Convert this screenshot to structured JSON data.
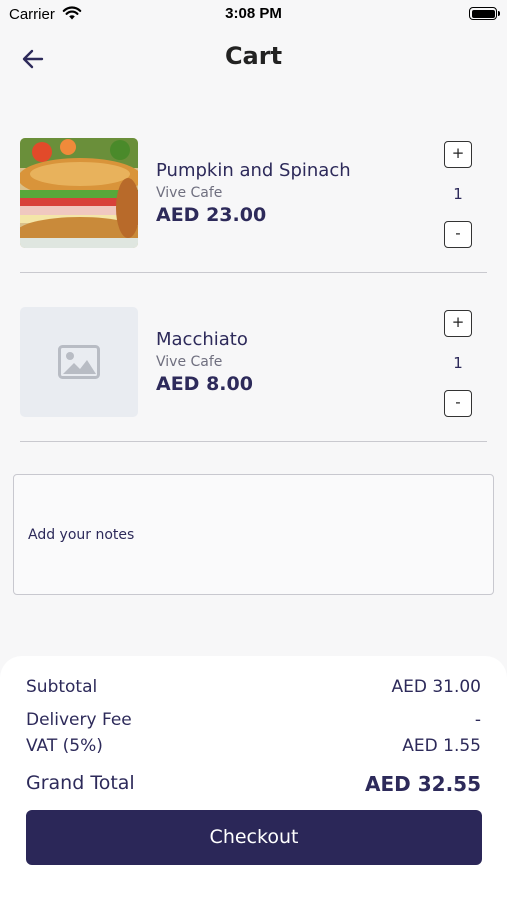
{
  "status_bar": {
    "carrier": "Carrier",
    "time": "3:08 PM",
    "wifi_icon": "wifi-icon",
    "battery_icon": "battery-icon"
  },
  "header": {
    "title": "Cart",
    "back_icon": "arrow-left-icon"
  },
  "cart": {
    "items": [
      {
        "name": "Pumpkin and Spinach",
        "vendor": "Vive Cafe",
        "price": "AED 23.00",
        "quantity": "1",
        "plus_label": "+",
        "minus_label": "-",
        "image": "sandwich-photo"
      },
      {
        "name": "Macchiato",
        "vendor": "Vive Cafe",
        "price": "AED 8.00",
        "quantity": "1",
        "plus_label": "+",
        "minus_label": "-",
        "image": "image-placeholder-icon"
      }
    ]
  },
  "notes": {
    "placeholder": "Add your notes"
  },
  "summary": {
    "subtotal_label": "Subtotal",
    "subtotal_value": "AED 31.00",
    "delivery_label": "Delivery Fee",
    "delivery_value": "-",
    "vat_label": "VAT (5%)",
    "vat_value": "AED 1.55",
    "grand_total_label": "Grand Total",
    "grand_total_value": "AED 32.55",
    "checkout_label": "Checkout"
  },
  "colors": {
    "primary": "#2b2758",
    "text": "#2d2a5a",
    "muted": "#6f6f7f",
    "background": "#f7f7f8"
  }
}
